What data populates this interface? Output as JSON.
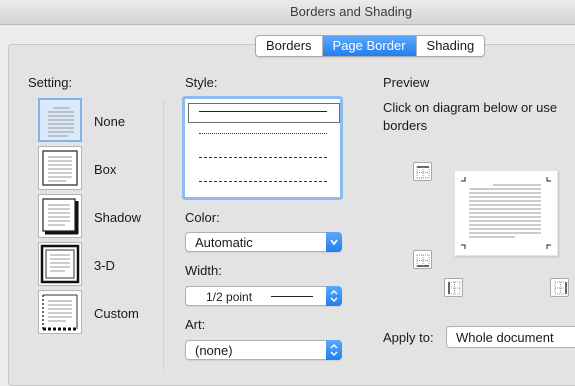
{
  "window": {
    "title": "Borders and Shading"
  },
  "tabs": [
    {
      "label": "Borders",
      "active": false
    },
    {
      "label": "Page Border",
      "active": true
    },
    {
      "label": "Shading",
      "active": false
    }
  ],
  "setting": {
    "label": "Setting:",
    "options": [
      {
        "label": "None",
        "icon": "none-setting-icon",
        "selected": true
      },
      {
        "label": "Box",
        "icon": "box-setting-icon",
        "selected": false
      },
      {
        "label": "Shadow",
        "icon": "shadow-setting-icon",
        "selected": false
      },
      {
        "label": "3-D",
        "icon": "3d-setting-icon",
        "selected": false
      },
      {
        "label": "Custom",
        "icon": "custom-setting-icon",
        "selected": false
      }
    ]
  },
  "style": {
    "label": "Style:",
    "options": [
      "solid",
      "dotted",
      "dashed",
      "long-dashed"
    ],
    "selected": "solid"
  },
  "color": {
    "label": "Color:",
    "value": "Automatic"
  },
  "width": {
    "label": "Width:",
    "value": "1/2 point"
  },
  "art": {
    "label": "Art:",
    "value": "(none)"
  },
  "preview": {
    "label": "Preview",
    "instruction_line1": "Click on diagram below or use",
    "instruction_line2": "borders"
  },
  "apply_to": {
    "label": "Apply to:",
    "value": "Whole document"
  },
  "colors": {
    "accent": "#1f7ff0",
    "selection": "#8ebbf0",
    "background": "#ececec"
  }
}
